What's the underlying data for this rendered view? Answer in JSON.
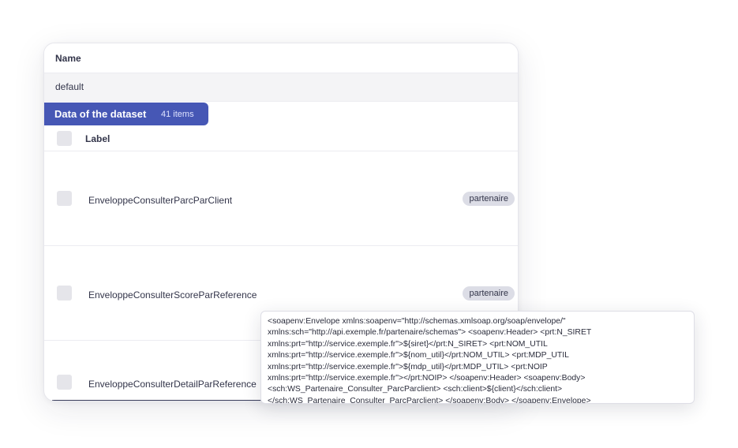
{
  "table": {
    "name_header": "Name",
    "name_value": "default"
  },
  "dataset": {
    "title": "Data of the dataset",
    "count": "41 items",
    "label_header": "Label",
    "rows": [
      {
        "label": "EnveloppeConsulterParcParClient",
        "tag": "partenaire"
      },
      {
        "label": "EnveloppeConsulterScoreParReference",
        "tag": "partenaire"
      },
      {
        "label": "EnveloppeConsulterDetailParReference",
        "tag": ""
      }
    ]
  },
  "tooltip": {
    "lines": [
      "<soapenv:Envelope xmlns:soapenv=\"http://schemas.xmlsoap.org/soap/envelope/\"",
      "xmlns:sch=\"http://api.exemple.fr/partenaire/schemas\"> <soapenv:Header> <prt:N_SIRET",
      "xmlns:prt=\"http://service.exemple.fr\">${siret}</prt:N_SIRET> <prt:NOM_UTIL",
      "xmlns:prt=\"http://service.exemple.fr\">${nom_util}</prt:NOM_UTIL> <prt:MDP_UTIL",
      "xmlns:prt=\"http://service.exemple.fr\">${mdp_util}</prt:MDP_UTIL> <prt:NOIP",
      "xmlns:prt=\"http://service.exemple.fr\"></prt:NOIP> </soapenv:Header> <soapenv:Body>",
      "<sch:WS_Partenaire_Consulter_ParcParclient> <sch:client>${client}</sch:client>",
      "</sch:WS_Partenaire_Consulter_ParcParclient> </soapenv:Body> </soapenv:Envelope>"
    ]
  }
}
